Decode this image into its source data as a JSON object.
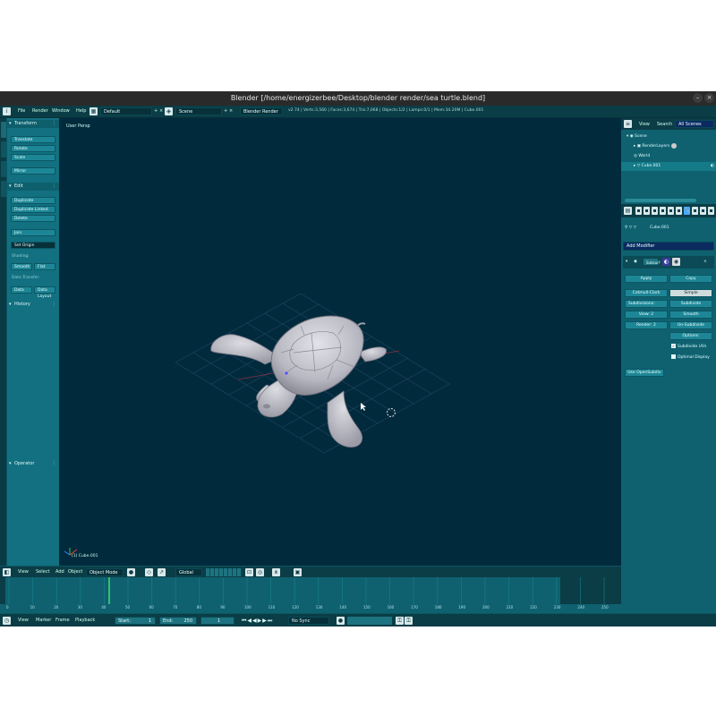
{
  "window": {
    "title": "Blender [/home/energizerbee/Desktop/blender render/sea turtle.blend]",
    "btn_min": "–",
    "btn_close": "×"
  },
  "info_header": {
    "menus": [
      "File",
      "Render",
      "Window",
      "Help"
    ],
    "screen_layout": "Default",
    "scene": "Scene",
    "render_engine": "Blender Render",
    "stats": "v2.74 | Verts:3,560 | Faces:3,674 | Tris:7,068 | Objects:1/2 | Lamps:0/1 | Mem:34.20M | Cube.001"
  },
  "tool_shelf": {
    "transform": {
      "header": "Transform",
      "buttons": [
        "Translate",
        "Rotate",
        "Scale",
        "Mirror"
      ]
    },
    "edit": {
      "header": "Edit",
      "buttons": [
        "Duplicate",
        "Duplicate Linked",
        "Delete",
        "Join"
      ],
      "set_origin": "Set Origin",
      "shading_label": "Shading:",
      "smooth": "Smooth",
      "flat": "Flat",
      "data_transfer_label": "Data Transfer:",
      "data": "Data",
      "data_layout": "Data Layout"
    },
    "history": {
      "header": "History"
    },
    "operator": {
      "header": "Operator"
    }
  },
  "viewport": {
    "view_label": "User Persp",
    "object_label": "(1) Cube.001"
  },
  "outliner": {
    "tabs": [
      "View",
      "Search",
      "All Scenes"
    ],
    "rows": [
      {
        "label": "Scene",
        "indent": 0
      },
      {
        "label": "RenderLayers",
        "indent": 1
      },
      {
        "label": "World",
        "indent": 1
      },
      {
        "label": "Cube.001",
        "indent": 1
      }
    ]
  },
  "properties": {
    "breadcrumb": "Cube.001",
    "add_modifier": "Add Modifier",
    "modifier_name": "Subsurf",
    "apply": "Apply",
    "copy": "Copy",
    "catmull_clark": "Catmull-Clark",
    "simple": "Simple",
    "subdivisions_label": "Subdivisions:",
    "view": "View: 2",
    "render": "Render: 2",
    "options_label": "Options:",
    "opt_subdivide_uvs": "Subdivide UVs",
    "opt_optimal_display": "Optimal Display",
    "use_opensubdiv": "Use OpenSubdiv",
    "unused_labels": [
      "Subdivide",
      "Smooth",
      "Un-Subdivide"
    ]
  },
  "view3d_header": {
    "menus": [
      "View",
      "Select",
      "Add",
      "Object"
    ],
    "mode": "Object Mode",
    "orientation": "Global"
  },
  "timeline": {
    "start_frame_marker": 1,
    "ticks": [
      "0",
      "10",
      "20",
      "30",
      "40",
      "50",
      "60",
      "70",
      "80",
      "90",
      "100",
      "110",
      "120",
      "130",
      "140",
      "150",
      "160",
      "170",
      "180",
      "190",
      "200",
      "210",
      "220",
      "230",
      "240",
      "250"
    ]
  },
  "playback_header": {
    "menus": [
      "View",
      "Marker",
      "Frame",
      "Playback"
    ],
    "start": "Start:",
    "start_val": "1",
    "end": "End:",
    "end_val": "250",
    "current": "1",
    "sync": "No Sync"
  },
  "colors": {
    "theme_panel": "#127080",
    "viewport_bg": "#022a3d",
    "header_bg": "#0b3d46",
    "turtle": "#c8c8d0"
  }
}
